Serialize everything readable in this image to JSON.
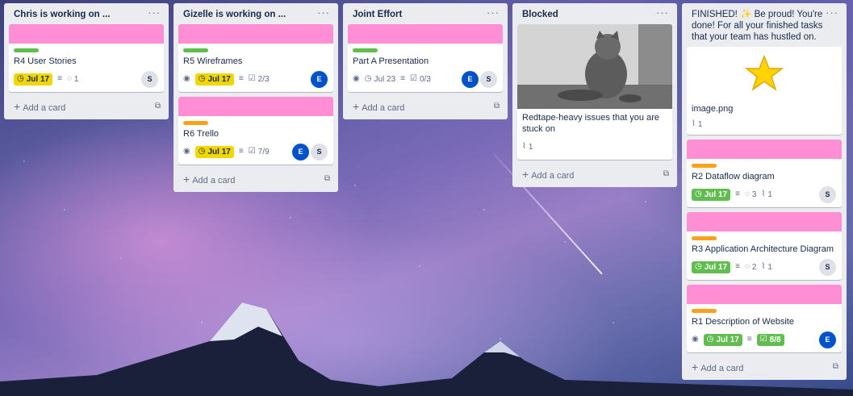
{
  "lists": [
    {
      "title": "Chris is working on ...",
      "add_card": "Add a card",
      "cards": [
        {
          "title": "R4 User Stories",
          "due": "Jul 17",
          "comments": "1",
          "members": [
            "S"
          ]
        }
      ]
    },
    {
      "title": "Gizelle is working on ...",
      "add_card": "Add a card",
      "cards": [
        {
          "title": "R5 Wireframes",
          "due": "Jul 17",
          "checklist": "2/3",
          "members": [
            "E"
          ]
        },
        {
          "title": "R6 Trello",
          "due": "Jul 17",
          "checklist": "7/9",
          "members": [
            "E",
            "S"
          ]
        }
      ]
    },
    {
      "title": "Joint Effort",
      "add_card": "Add a card",
      "cards": [
        {
          "title": "Part A Presentation",
          "due": "Jul 23",
          "checklist": "0/3",
          "members": [
            "E",
            "S"
          ]
        }
      ]
    },
    {
      "title": "Blocked",
      "add_card": "Add a card",
      "cards": [
        {
          "title": "Redtape-heavy issues that you are stuck on",
          "attachments": "1"
        }
      ]
    },
    {
      "title": "FINISHED! ✨ Be proud! You're done! For all your finished tasks that your team has hustled on.",
      "add_card": "Add a card",
      "cards": [
        {
          "title": "image.png",
          "attachments": "1"
        },
        {
          "title": "R2 Dataflow diagram",
          "due": "Jul 17",
          "comments": "3",
          "attachments": "1",
          "members": [
            "S"
          ]
        },
        {
          "title": "R3 Application Architecture Diagram",
          "due": "Jul 17",
          "comments": "2",
          "attachments": "1",
          "members": [
            "S"
          ]
        },
        {
          "title": "R1 Description of Website",
          "due": "Jul 17",
          "checklist": "8/8",
          "members": [
            "E"
          ]
        }
      ]
    }
  ],
  "colors": {
    "cover_pink": "#ff8ed4",
    "label_green": "#61bd4f",
    "label_orange": "#ff9f1a",
    "due_yellow": "#f2d600",
    "avatar_blue": "#0052cc"
  },
  "icons": {
    "watch": "eye-icon",
    "due": "clock-icon",
    "description": "description-icon",
    "comments": "comment-icon",
    "checklist": "checklist-icon",
    "attachment": "paperclip-icon",
    "template": "card-template-icon",
    "menu": "more-icon",
    "add": "plus-icon"
  }
}
